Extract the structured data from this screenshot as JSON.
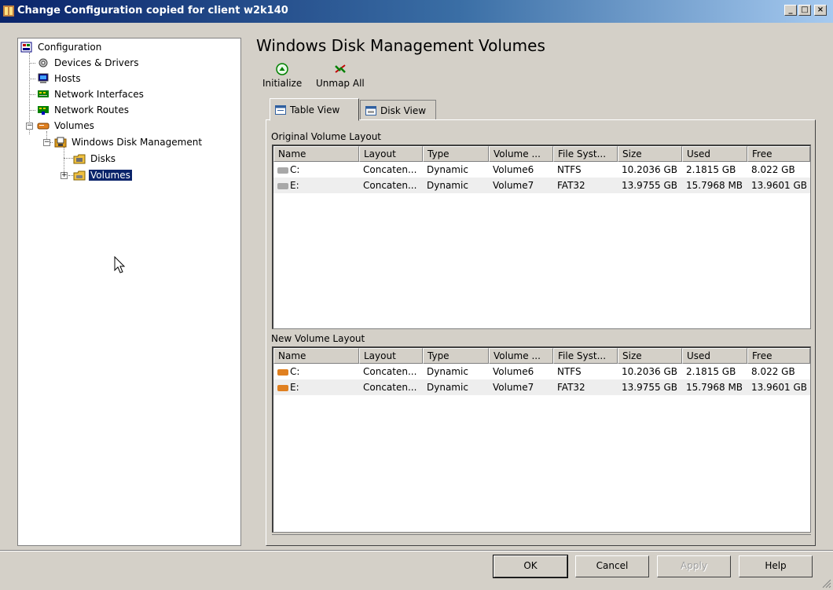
{
  "window": {
    "title": "Change Configuration copied for client w2k140",
    "controls": {
      "minimize": "_",
      "maximize": "□",
      "close": "×"
    }
  },
  "tree": {
    "items": [
      {
        "label": "Configuration",
        "icon": "configuration-icon"
      },
      {
        "label": "Devices & Drivers",
        "icon": "devices-gear-icon"
      },
      {
        "label": "Hosts",
        "icon": "computer-icon"
      },
      {
        "label": "Network Interfaces",
        "icon": "network-interface-icon"
      },
      {
        "label": "Network Routes",
        "icon": "network-routes-icon"
      },
      {
        "label": "Volumes",
        "icon": "drive-icon"
      },
      {
        "label": "Windows Disk Management",
        "icon": "disk-management-icon"
      },
      {
        "label": "Disks",
        "icon": "folder-disk-icon"
      },
      {
        "label": "Volumes",
        "icon": "folder-volume-icon",
        "selected": true
      }
    ]
  },
  "main": {
    "title": "Windows Disk Management Volumes",
    "toolbar": {
      "initialize_label": "Initialize",
      "unmap_all_label": "Unmap All"
    },
    "tabs": [
      {
        "label": "Table View",
        "active": true
      },
      {
        "label": "Disk View",
        "active": false
      }
    ],
    "original_layout": {
      "label": "Original Volume Layout",
      "columns": [
        "Name",
        "Layout",
        "Type",
        "Volume ...",
        "File Syst...",
        "Size",
        "Used",
        "Free"
      ],
      "rows": [
        [
          "C:",
          "Concaten...",
          "Dynamic",
          "Volume6",
          "NTFS",
          "10.2036 GB",
          "2.1815 GB",
          "8.022 GB"
        ],
        [
          "E:",
          "Concaten...",
          "Dynamic",
          "Volume7",
          "FAT32",
          "13.9755 GB",
          "15.7968 MB",
          "13.9601 GB"
        ]
      ]
    },
    "new_layout": {
      "label": "New Volume Layout",
      "columns": [
        "Name",
        "Layout",
        "Type",
        "Volume ...",
        "File Syst...",
        "Size",
        "Used",
        "Free"
      ],
      "rows": [
        [
          "C:",
          "Concaten...",
          "Dynamic",
          "Volume6",
          "NTFS",
          "10.2036 GB",
          "2.1815 GB",
          "8.022 GB"
        ],
        [
          "E:",
          "Concaten...",
          "Dynamic",
          "Volume7",
          "FAT32",
          "13.9755 GB",
          "15.7968 MB",
          "13.9601 GB"
        ]
      ]
    }
  },
  "buttons": {
    "ok": "OK",
    "cancel": "Cancel",
    "apply": "Apply",
    "help": "Help"
  },
  "colors": {
    "title_bar_start": "#0a246a",
    "title_bar_end": "#a6caf0",
    "selection": "#0a246a",
    "face": "#d4d0c8",
    "original_drive_icon": "#a8a8a8",
    "new_drive_icon": "#e08020"
  }
}
